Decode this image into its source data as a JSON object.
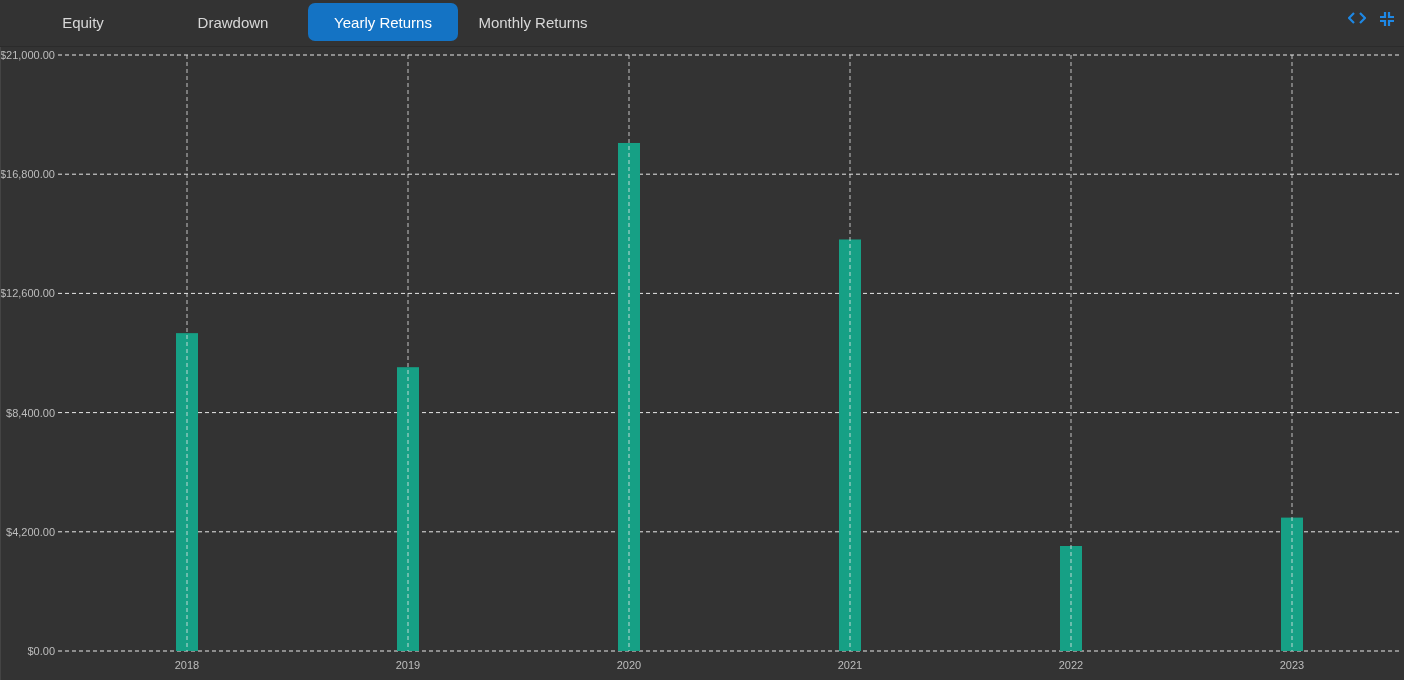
{
  "tabs": [
    {
      "label": "Equity",
      "selected": false
    },
    {
      "label": "Drawdown",
      "selected": false
    },
    {
      "label": "Yearly Returns",
      "selected": true
    },
    {
      "label": "Monthly Returns",
      "selected": false
    }
  ],
  "chart_data": {
    "type": "bar",
    "categories": [
      "2018",
      "2019",
      "2020",
      "2021",
      "2022",
      "2023"
    ],
    "grid": true,
    "series": [
      {
        "color": "#16a085",
        "values": [
          11200,
          10000,
          17900,
          14500,
          3700,
          4700
        ]
      }
    ],
    "ylim": [
      0,
      21000
    ],
    "yticks": [
      {
        "value": 0,
        "label": "$0.00"
      },
      {
        "value": 4200,
        "label": "$4,200.00"
      },
      {
        "value": 8400,
        "label": "$8,400.00"
      },
      {
        "value": 12600,
        "label": "$12,600.00"
      },
      {
        "value": 16800,
        "label": "$16,800.00"
      },
      {
        "value": 21000,
        "label": "$21,000.00"
      }
    ]
  }
}
